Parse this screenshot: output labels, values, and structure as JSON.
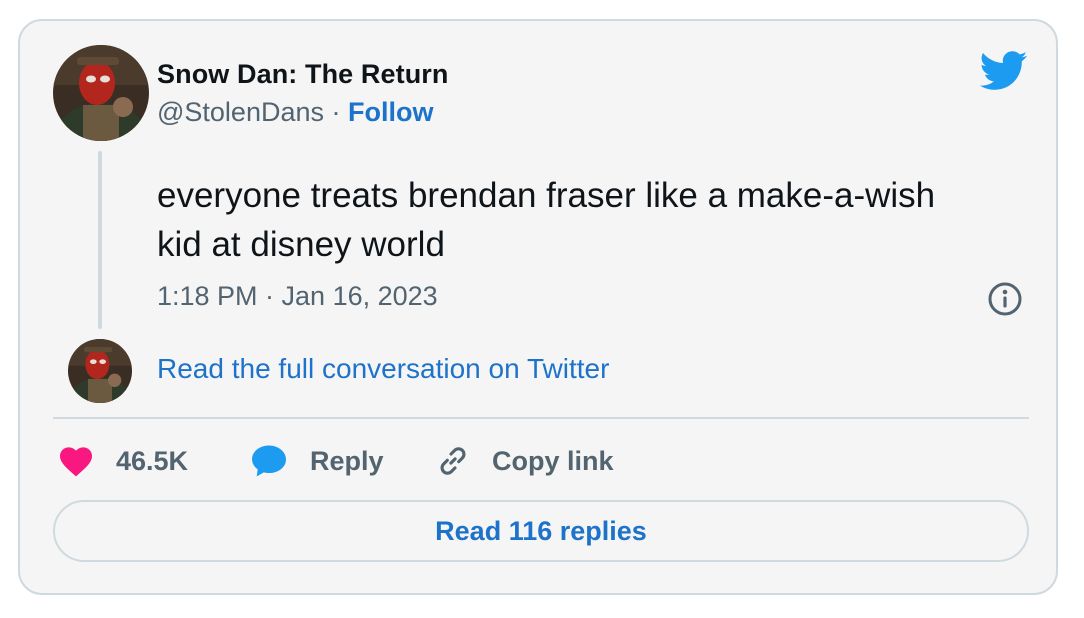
{
  "tweet": {
    "author_name": "Snow Dan: The Return",
    "handle": "@StolenDans",
    "separator": " · ",
    "follow_label": "Follow",
    "text": "everyone treats brendan fraser like a make-a-wish kid at disney world",
    "timestamp": "1:18 PM · Jan 16, 2023",
    "read_conversation_label": "Read the full conversation on Twitter"
  },
  "actions": {
    "like_count": "46.5K",
    "reply_label": "Reply",
    "copy_link_label": "Copy link"
  },
  "footer": {
    "read_replies_label": "Read 116 replies"
  },
  "icons": {
    "brand": "twitter-bird-icon",
    "info": "info-icon",
    "like": "heart-icon",
    "reply": "speech-bubble-icon",
    "copy": "link-icon"
  },
  "colors": {
    "link_blue": "#1d72c9",
    "twitter_blue": "#1d9bf0",
    "like_pink": "#f91880",
    "muted": "#536471",
    "border": "#cfd9de",
    "background": "#f5f5f5"
  }
}
